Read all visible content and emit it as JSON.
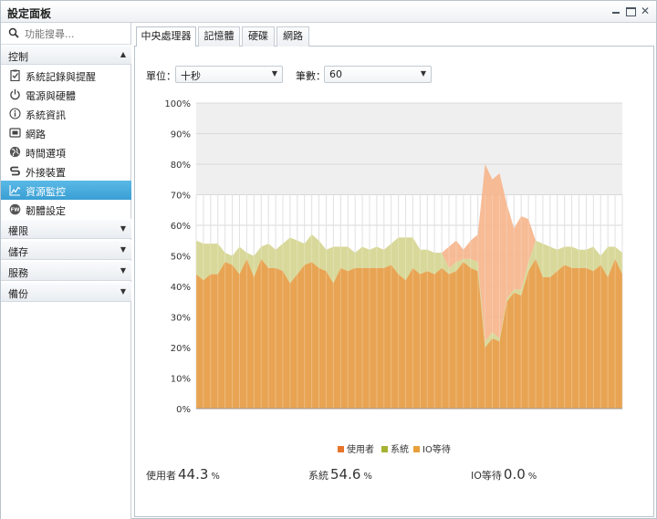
{
  "window": {
    "title": "設定面板"
  },
  "search": {
    "placeholder": "功能搜尋..."
  },
  "sidebar": {
    "groups": [
      {
        "label": "控制",
        "expanded": true
      },
      {
        "label": "權限",
        "expanded": false
      },
      {
        "label": "儲存",
        "expanded": false
      },
      {
        "label": "服務",
        "expanded": false
      },
      {
        "label": "備份",
        "expanded": false
      }
    ],
    "items": [
      {
        "label": "系統記錄與提醒",
        "icon": "clipboard-check-icon"
      },
      {
        "label": "電源與硬體",
        "icon": "power-icon"
      },
      {
        "label": "系統資訊",
        "icon": "info-icon"
      },
      {
        "label": "網路",
        "icon": "network-monitor-icon"
      },
      {
        "label": "時間選項",
        "icon": "globe-clock-icon"
      },
      {
        "label": "外接裝置",
        "icon": "usb-device-icon"
      },
      {
        "label": "資源監控",
        "icon": "line-chart-icon",
        "active": true
      },
      {
        "label": "韌體設定",
        "icon": "firmware-icon"
      }
    ]
  },
  "tabs": [
    {
      "label": "中央處理器",
      "active": true
    },
    {
      "label": "記憶體",
      "active": false
    },
    {
      "label": "硬碟",
      "active": false
    },
    {
      "label": "網路",
      "active": false
    }
  ],
  "controls": {
    "unit_label": "單位：",
    "unit_value": "十秒",
    "count_label": "筆數：",
    "count_value": "60"
  },
  "colors": {
    "user": "#e8a453",
    "system": "#d8d89a",
    "iowait": "#f6b48a",
    "plot_bg": "#efefef",
    "grid": "#d9d9d9",
    "legend_user": "#e8742a",
    "legend_system": "#a6b232",
    "legend_iowait": "#e8a03a"
  },
  "chart_data": {
    "type": "area",
    "stacked": true,
    "x": [
      1,
      2,
      3,
      4,
      5,
      6,
      7,
      8,
      9,
      10,
      11,
      12,
      13,
      14,
      15,
      16,
      17,
      18,
      19,
      20,
      21,
      22,
      23,
      24,
      25,
      26,
      27,
      28,
      29,
      30,
      31,
      32,
      33,
      34,
      35,
      36,
      37,
      38,
      39,
      40,
      41,
      42,
      43,
      44,
      45,
      46,
      47,
      48,
      49,
      50,
      51,
      52,
      53,
      54,
      55,
      56,
      57,
      58,
      59,
      60
    ],
    "ylim": [
      0,
      100
    ],
    "yticks": [
      "0%",
      "10%",
      "20%",
      "30%",
      "40%",
      "50%",
      "60%",
      "70%",
      "80%",
      "90%",
      "100%"
    ],
    "grid": true,
    "legend_position": "bottom",
    "series": [
      {
        "name": "使用者",
        "values": [
          44,
          42,
          44,
          44,
          48,
          47,
          44,
          49,
          43,
          49,
          46,
          46,
          45,
          41,
          44,
          47,
          48,
          46,
          45,
          41,
          46,
          45,
          46,
          46,
          46,
          46,
          46,
          47,
          44,
          42,
          46,
          44,
          45,
          44,
          46,
          44,
          45,
          48,
          46,
          45,
          20,
          23,
          22,
          35,
          38,
          37,
          45,
          49,
          43,
          43,
          45,
          47,
          46,
          46,
          46,
          45,
          47,
          43,
          49,
          44
        ]
      },
      {
        "name": "系統",
        "values": [
          11,
          12,
          10,
          10,
          3,
          3,
          9,
          2,
          7,
          4,
          8,
          6,
          9,
          15,
          11,
          7,
          9,
          9,
          7,
          12,
          7,
          8,
          5,
          7,
          6,
          7,
          6,
          7,
          12,
          14,
          10,
          8,
          7,
          7,
          5,
          2,
          3,
          1,
          3,
          3,
          2,
          2,
          1,
          1,
          1,
          2,
          3,
          6,
          11,
          10,
          7,
          6,
          7,
          6,
          6,
          8,
          3,
          10,
          4,
          7
        ]
      },
      {
        "name": "IO等待",
        "values": [
          0,
          0,
          0,
          0,
          0,
          0,
          0,
          0,
          0,
          0,
          0,
          0,
          0,
          0,
          0,
          0,
          0,
          0,
          0,
          0,
          0,
          0,
          0,
          0,
          0,
          0,
          0,
          0,
          0,
          0,
          0,
          0,
          0,
          0,
          0,
          7,
          7,
          3,
          6,
          9,
          58,
          50,
          54,
          31,
          20,
          24,
          14,
          0,
          0,
          0,
          0,
          0,
          0,
          0,
          0,
          0,
          0,
          0,
          0,
          0
        ]
      }
    ]
  },
  "stats": [
    {
      "label": "使用者",
      "value": "44.3",
      "unit": "%"
    },
    {
      "label": "系統",
      "value": "54.6",
      "unit": "%"
    },
    {
      "label": "IO等待",
      "value": "0.0",
      "unit": "%"
    }
  ]
}
